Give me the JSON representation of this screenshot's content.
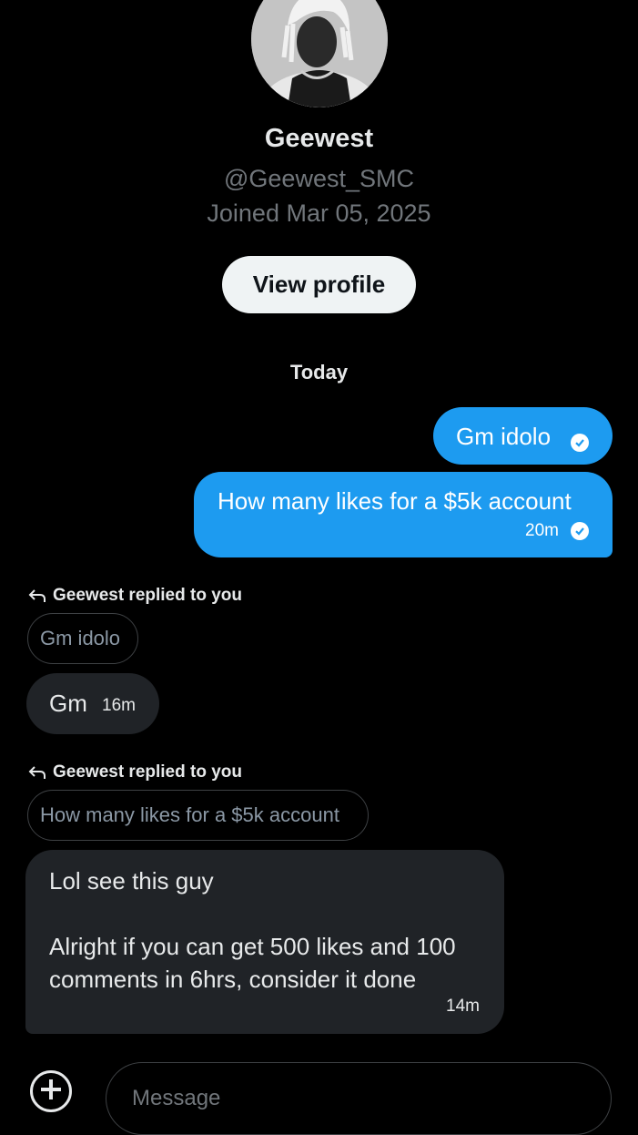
{
  "profile": {
    "name": "Geewest",
    "handle": "@Geewest_SMC",
    "joined": "Joined Mar 05, 2025",
    "view_profile_label": "View profile"
  },
  "date_divider": "Today",
  "messages": [
    {
      "direction": "outgoing",
      "text": "Gm idolo",
      "time": "",
      "status_icon": "check-circle-icon"
    },
    {
      "direction": "outgoing",
      "text": "How many likes for a $5k account",
      "time": "20m",
      "status_icon": "check-circle-icon"
    },
    {
      "direction": "incoming",
      "reply_label": "Geewest replied to you",
      "quoted_text": "Gm idolo",
      "text": "Gm",
      "time": "16m"
    },
    {
      "direction": "incoming",
      "reply_label": "Geewest replied to you",
      "quoted_text": "How many likes for a $5k account",
      "text_line1": "Lol see this guy",
      "text_line2": "Alright if you can get 500 likes and 100 comments in 6hrs, consider it done",
      "time": "14m"
    }
  ],
  "composer": {
    "placeholder": "Message",
    "add_icon": "plus-circle-icon"
  },
  "colors": {
    "background": "#000000",
    "outgoing_bubble": "#1d9bf0",
    "incoming_bubble": "#202327",
    "secondary_text": "#71767b"
  }
}
